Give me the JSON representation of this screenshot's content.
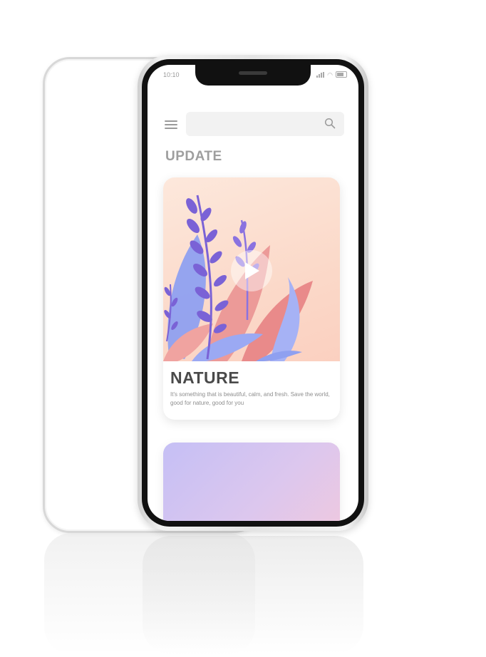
{
  "status_bar": {
    "time": "10:10"
  },
  "search": {
    "placeholder": ""
  },
  "feed": {
    "section_title": "UPDATE",
    "cards": [
      {
        "title": "NATURE",
        "description": "It's something that is beautiful, calm, and fresh. Save the world, good for nature, good for you"
      }
    ]
  },
  "colors": {
    "title_gray": "#9e9e9e",
    "card_title": "#4a4a4a",
    "card_art_bg": "#fbd9c9",
    "leaf_purple": "#7a62d6",
    "leaf_blue": "#8fa0f0",
    "leaf_pink": "#e98a8a",
    "card2_gradient_start": "#c5bff5",
    "card2_gradient_end": "#f1c8dd"
  }
}
